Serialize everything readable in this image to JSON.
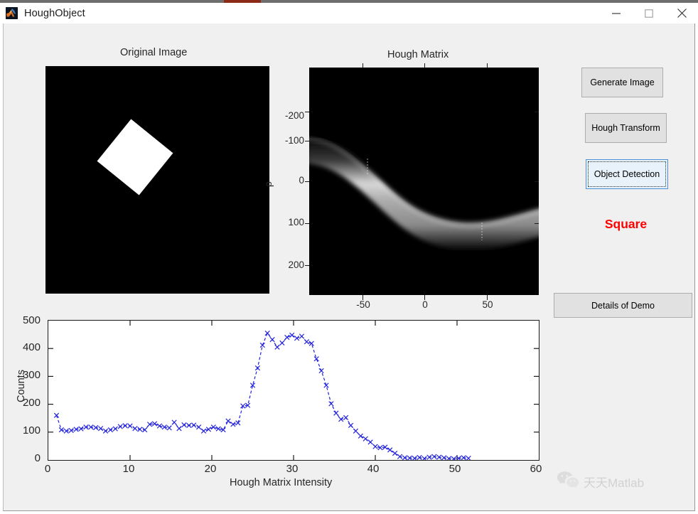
{
  "window": {
    "title": "HoughObject",
    "icon": "matlab-icon",
    "controls": [
      {
        "name": "minimize-button",
        "glyph": "minimize-icon"
      },
      {
        "name": "maximize-button",
        "glyph": "maximize-icon"
      },
      {
        "name": "close-button",
        "glyph": "close-icon"
      }
    ]
  },
  "panels": {
    "original_image": {
      "title": "Original Image",
      "content": "black background with white rotated square"
    },
    "hough_matrix": {
      "title": "Hough Matrix",
      "ylabel": "ρ",
      "ytick_labels": [
        "-200",
        "-100",
        "0",
        "100",
        "200"
      ],
      "xtick_labels": [
        "-50",
        "0",
        "50"
      ]
    }
  },
  "buttons": [
    {
      "name": "generate-image-button",
      "label": "Generate Image",
      "focused": false
    },
    {
      "name": "hough-transform-button",
      "label": "Hough Transform",
      "focused": false
    },
    {
      "name": "object-detection-button",
      "label": "Object Detection",
      "focused": true
    },
    {
      "name": "details-of-demo-button",
      "label": "Details of Demo",
      "focused": false
    }
  ],
  "detected_shape": {
    "label": "Square",
    "color": "#ff0000"
  },
  "watermark": {
    "text": "天天Matlab",
    "icon": "wechat-icon"
  },
  "chart_data": {
    "type": "line",
    "title": "",
    "xlabel": "Hough Matrix Intensity",
    "ylabel": "Counts",
    "xlim": [
      0,
      60
    ],
    "ylim": [
      0,
      500
    ],
    "xticks": [
      0,
      10,
      20,
      30,
      40,
      50,
      60
    ],
    "yticks": [
      0,
      100,
      200,
      300,
      400,
      500
    ],
    "grid": false,
    "legend": null,
    "marker": "x",
    "line_style": "dashed",
    "color": "#2222dd",
    "series": [
      {
        "name": "Counts",
        "x": [
          1.0,
          1.6,
          2.2,
          2.8,
          3.4,
          4.0,
          4.6,
          5.2,
          5.8,
          6.4,
          7.0,
          7.6,
          8.2,
          8.8,
          9.4,
          10.0,
          10.6,
          11.2,
          11.8,
          12.4,
          13.0,
          13.6,
          14.2,
          14.8,
          15.4,
          16.0,
          16.6,
          17.2,
          17.8,
          18.4,
          19.0,
          19.6,
          20.2,
          20.8,
          21.4,
          22.0,
          22.6,
          23.2,
          23.8,
          24.4,
          25.0,
          25.6,
          26.2,
          26.8,
          27.4,
          28.0,
          28.6,
          29.2,
          29.8,
          30.4,
          31.0,
          31.6,
          32.2,
          32.8,
          33.4,
          34.0,
          34.6,
          35.2,
          35.8,
          36.4,
          37.0,
          37.6,
          38.2,
          38.8,
          39.4,
          40.0,
          40.6,
          41.2,
          41.8,
          42.4,
          43.0,
          43.6,
          44.2,
          44.8,
          45.4,
          46.0,
          46.6,
          47.2,
          47.8,
          48.4,
          49.0,
          49.6,
          50.2,
          50.8,
          51.4
        ],
        "values": [
          160,
          108,
          104,
          106,
          110,
          112,
          118,
          118,
          116,
          113,
          104,
          108,
          112,
          120,
          123,
          122,
          113,
          110,
          108,
          128,
          130,
          122,
          118,
          115,
          135,
          113,
          126,
          124,
          125,
          118,
          104,
          110,
          118,
          112,
          108,
          140,
          128,
          133,
          194,
          196,
          268,
          330,
          412,
          455,
          432,
          405,
          420,
          440,
          448,
          437,
          444,
          424,
          418,
          363,
          320,
          268,
          202,
          168,
          146,
          152,
          124,
          104,
          86,
          76,
          64,
          48,
          44,
          46,
          36,
          24,
          12,
          8,
          7,
          6,
          9,
          5,
          10,
          12,
          10,
          8,
          5,
          4,
          6,
          8,
          6
        ]
      }
    ]
  }
}
